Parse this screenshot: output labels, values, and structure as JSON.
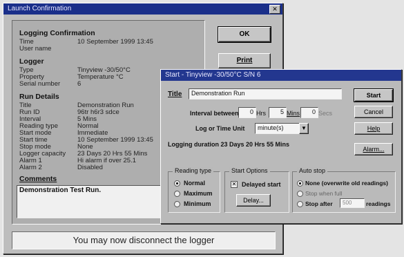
{
  "launch": {
    "title": "Launch Confirmation",
    "close_glyph": "✕",
    "sections": {
      "logging_confirmation": "Logging Confirmation",
      "logger": "Logger",
      "run_details": "Run Details",
      "comments": "Comments"
    },
    "confirmation_rows": [
      {
        "key": "Time",
        "value": "10 September 1999 13:45"
      },
      {
        "key": "User name",
        "value": ""
      }
    ],
    "logger_rows": [
      {
        "key": "Type",
        "value": "Tinyview -30/50°C"
      },
      {
        "key": "Property",
        "value": "Temperature °C"
      },
      {
        "key": "Serial number",
        "value": "6"
      }
    ],
    "run_rows": [
      {
        "key": "Title",
        "value": "Demonstration Run"
      },
      {
        "key": "Run ID",
        "value": "96tr h6r3 sdce"
      },
      {
        "key": "Interval",
        "value": "5 Mins"
      },
      {
        "key": "Reading type",
        "value": "Normal"
      },
      {
        "key": "Start mode",
        "value": "Immediate"
      },
      {
        "key": "Start time",
        "value": "10 September 1999 13:45"
      },
      {
        "key": "Stop mode",
        "value": "None"
      },
      {
        "key": "Logger capacity",
        "value": "23 Days 20 Hrs 55 Mins"
      },
      {
        "key": "Alarm 1",
        "value": "Hi alarm if over 25.1"
      },
      {
        "key": "Alarm 2",
        "value": "Disabled"
      }
    ],
    "comment_text": "Demonstration Test Run.",
    "ok_label": "OK",
    "print_label": "Print",
    "status_message": "You may now disconnect the logger"
  },
  "start": {
    "title": "Start - Tinyview -30/50°C S/N 6",
    "title_label": "Title",
    "title_value": "Demonstration Run",
    "interval_label": "Interval between",
    "hrs_value": "0",
    "hrs_unit": "Hrs",
    "mins_value": "5",
    "mins_unit": "Mins",
    "secs_value": "0",
    "secs_unit": "Secs",
    "log_unit_label": "Log or Time Unit",
    "log_unit_value": "minute(s)",
    "duration_text": "Logging duration  23 Days 20 Hrs 55 Mins",
    "reading_type": {
      "title": "Reading type",
      "options": [
        "Normal",
        "Maximum",
        "Minimum"
      ]
    },
    "start_options": {
      "title": "Start Options",
      "delayed_label": "Delayed start",
      "delay_button": "Delay..."
    },
    "auto_stop": {
      "title": "Auto stop",
      "option1": "None (overwrite old readings)",
      "option2": "Stop when full",
      "option3_pre": "Stop after",
      "option3_value": "500",
      "option3_post": "readings"
    },
    "buttons": {
      "start": "Start",
      "cancel": "Cancel",
      "help": "Help",
      "alarm": "Alarm..."
    }
  }
}
